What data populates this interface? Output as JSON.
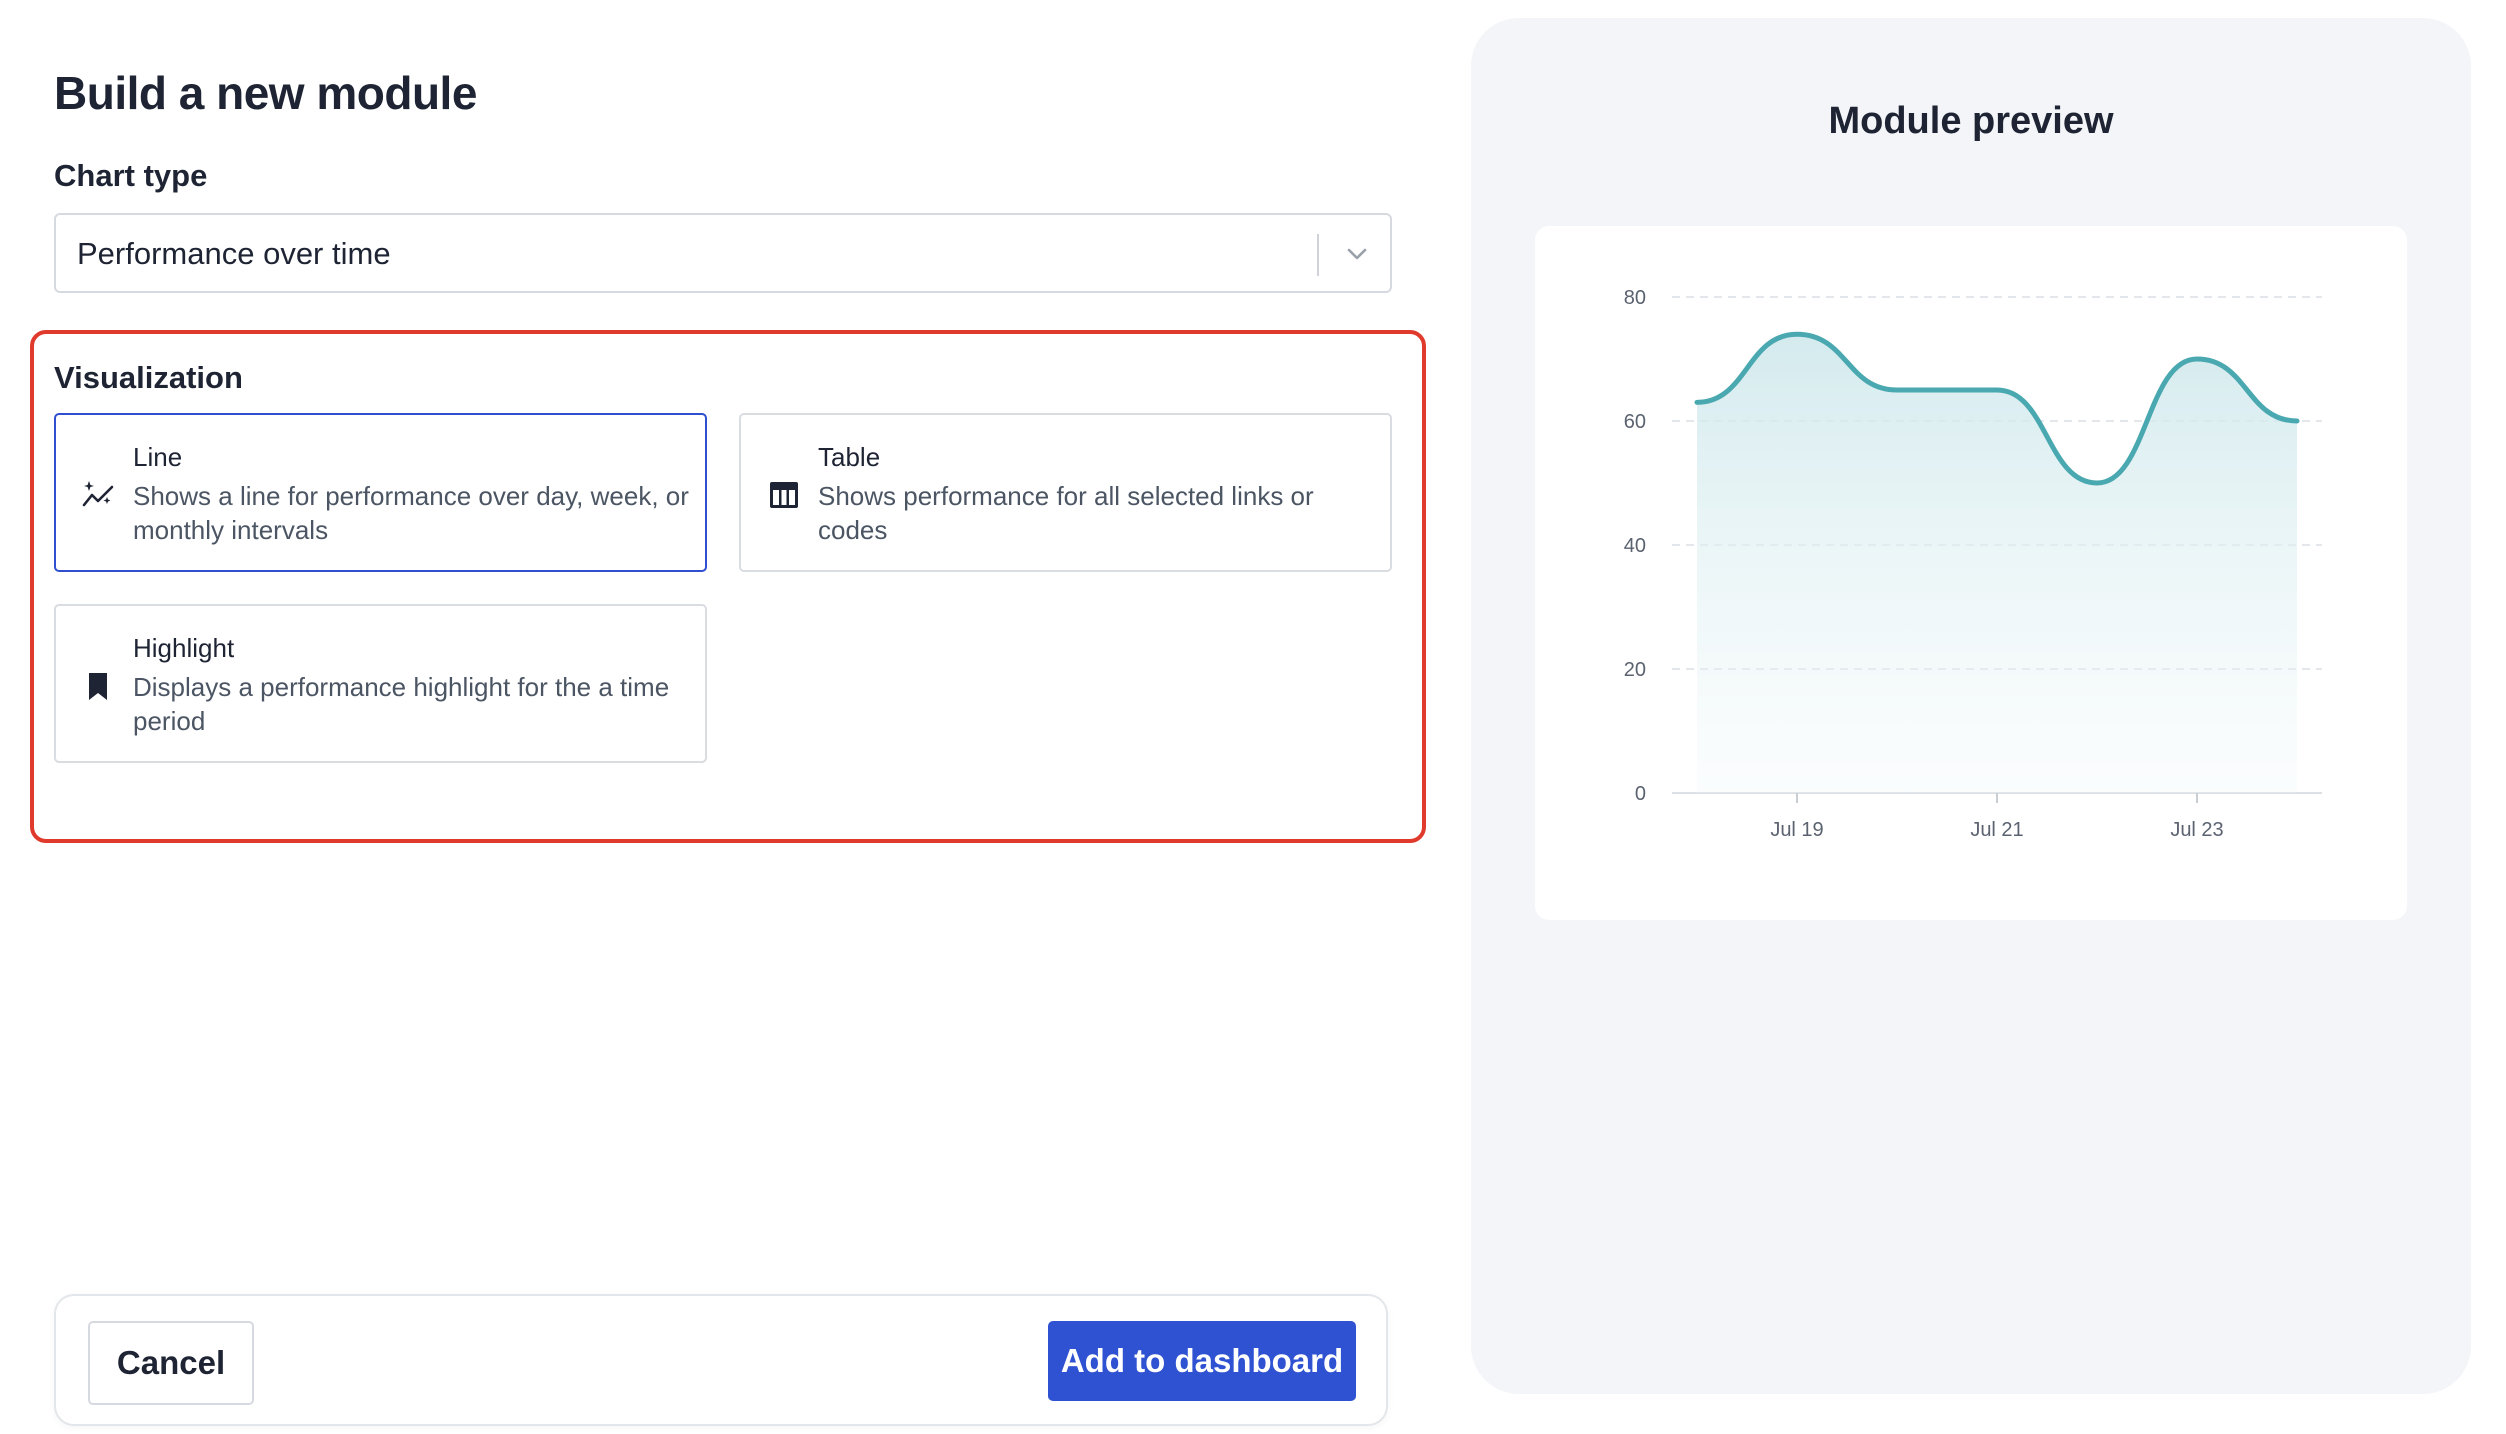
{
  "page": {
    "title": "Build a new module"
  },
  "chart_type": {
    "label": "Chart type",
    "value": "Performance over time"
  },
  "visualization": {
    "title": "Visualization",
    "options": [
      {
        "name": "Line",
        "description_line1": "Shows a line for performance over day, week, or",
        "description_line2": "monthly intervals",
        "icon": "line-chart-sparkle-icon",
        "selected": true
      },
      {
        "name": "Table",
        "description_line1": "Shows performance for all selected links or codes",
        "description_line2": "",
        "icon": "table-icon",
        "selected": false
      },
      {
        "name": "Highlight",
        "description_line1": "Displays a performance highlight for the a time",
        "description_line2": "period",
        "icon": "bookmark-icon",
        "selected": false
      }
    ]
  },
  "footer": {
    "cancel_label": "Cancel",
    "add_label": "Add to dashboard"
  },
  "preview": {
    "title": "Module preview"
  },
  "colors": {
    "accent": "#2f52d2",
    "highlight_border": "#e03a2c",
    "series_line": "#4aa8b0"
  },
  "chart_data": {
    "type": "area",
    "title": "",
    "xlabel": "",
    "ylabel": "",
    "ylim": [
      0,
      80
    ],
    "yticks": [
      0,
      20,
      40,
      60,
      80
    ],
    "xtick_labels": [
      "Jul 19",
      "Jul 21",
      "Jul 23"
    ],
    "xtick_positions": [
      1.25,
      3.25,
      5.25
    ],
    "xlim": [
      0,
      6.5
    ],
    "grid": true,
    "series": [
      {
        "x": [
          0.25,
          1.25,
          2.25,
          3.25,
          4.25,
          5.25,
          6.25
        ],
        "values": [
          63,
          74,
          65,
          65,
          50,
          70,
          60
        ]
      }
    ]
  }
}
